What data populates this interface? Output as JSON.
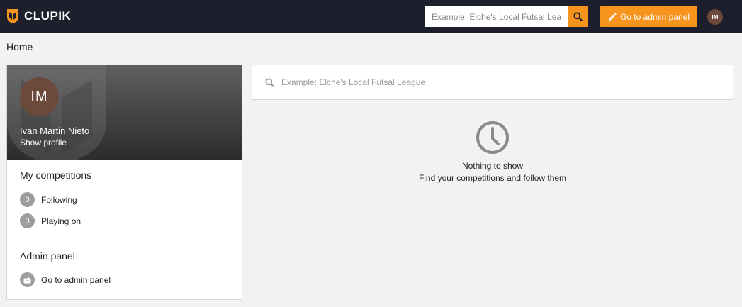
{
  "app": {
    "brand": "CLUPIK",
    "accent_color": "#f7941d",
    "header_bg": "#1d1f2c"
  },
  "header": {
    "search_placeholder": "Example: Elche's Local Futsal League",
    "search_icon": "search-icon",
    "admin_button_label": "Go to admin panel",
    "admin_button_icon": "pencil-icon",
    "avatar_initials": "IM"
  },
  "breadcrumb": "Home",
  "profile": {
    "initials": "IM",
    "name": "Ivan Martin Nieto",
    "show_profile_label": "Show profile"
  },
  "competitions": {
    "title": "My competitions",
    "items": [
      {
        "count": "0",
        "label": "Following"
      },
      {
        "count": "0",
        "label": "Playing on"
      }
    ]
  },
  "admin": {
    "title": "Admin panel",
    "link_label": "Go to admin panel",
    "link_icon": "briefcase-icon"
  },
  "main": {
    "search_placeholder": "Example: Elche's Local Futsal League",
    "empty_icon": "clock-icon",
    "empty_title": "Nothing to show",
    "empty_subtitle": "Find your competitions and follow them"
  }
}
